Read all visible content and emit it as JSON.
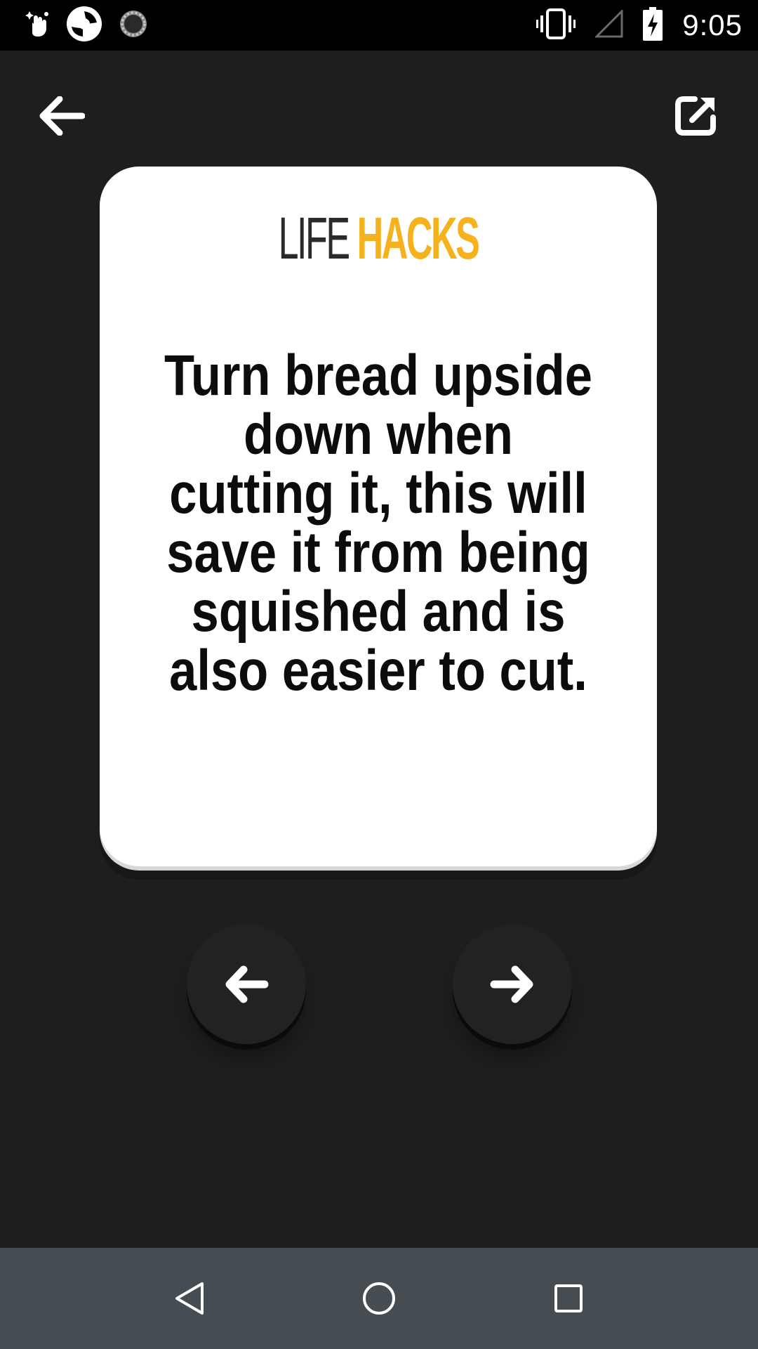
{
  "status_bar": {
    "time": "9:05",
    "left_icons": [
      "hand-sparkle-icon",
      "shutter-app-icon",
      "loading-spinner-icon"
    ],
    "right_icons": [
      "vibrate-icon",
      "signal-empty-icon",
      "battery-charging-icon"
    ]
  },
  "toolbar": {
    "back_icon": "arrow-left-icon",
    "share_icon": "share-external-icon"
  },
  "card": {
    "logo_part1": "LIFE",
    "logo_part2": "HACKS",
    "hack_text": "Turn bread upside down when cutting it, this will save it from being squished and is also easier to cut."
  },
  "navigation": {
    "prev_icon": "arrow-left-bold-icon",
    "next_icon": "arrow-right-bold-icon"
  },
  "system_nav": {
    "back": "triangle-back-icon",
    "home": "circle-home-icon",
    "recents": "square-recents-icon"
  },
  "colors": {
    "background": "#1e1e20",
    "card": "#ffffff",
    "accent": "#f5b21c",
    "nav_bar": "#454c52"
  }
}
